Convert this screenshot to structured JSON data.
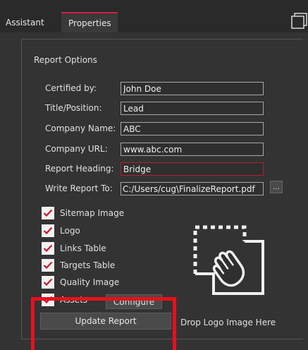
{
  "tabs": [
    {
      "label": "Assistant",
      "active": false
    },
    {
      "label": "Properties",
      "active": true
    }
  ],
  "accent_color": "#cc2244",
  "report_options": {
    "title": "Report Options",
    "fields": [
      {
        "label": "Certified by:",
        "value": "John Doe"
      },
      {
        "label": "Title/Position:",
        "value": "Lead"
      },
      {
        "label": "Company Name:",
        "value": "ABC"
      },
      {
        "label": "Company URL:",
        "value": "www.abc.com"
      },
      {
        "label": "Report Heading:",
        "value": "Bridge"
      },
      {
        "label": "Write Report To:",
        "value": "C:/Users/cug\\FinalizeReport.pdf"
      }
    ],
    "browse_label": "...",
    "checkboxes": [
      {
        "label": "Sitemap Image",
        "checked": true
      },
      {
        "label": "Logo",
        "checked": true
      },
      {
        "label": "Links Table",
        "checked": true
      },
      {
        "label": "Targets Table",
        "checked": true
      },
      {
        "label": "Quality Image",
        "checked": true
      },
      {
        "label": "Assets",
        "checked": true
      }
    ],
    "configure_label": "Configure",
    "update_label": "Update Report",
    "drop_text": "Drop Logo Image Here",
    "drop_icon": "hand-grab-icon"
  }
}
